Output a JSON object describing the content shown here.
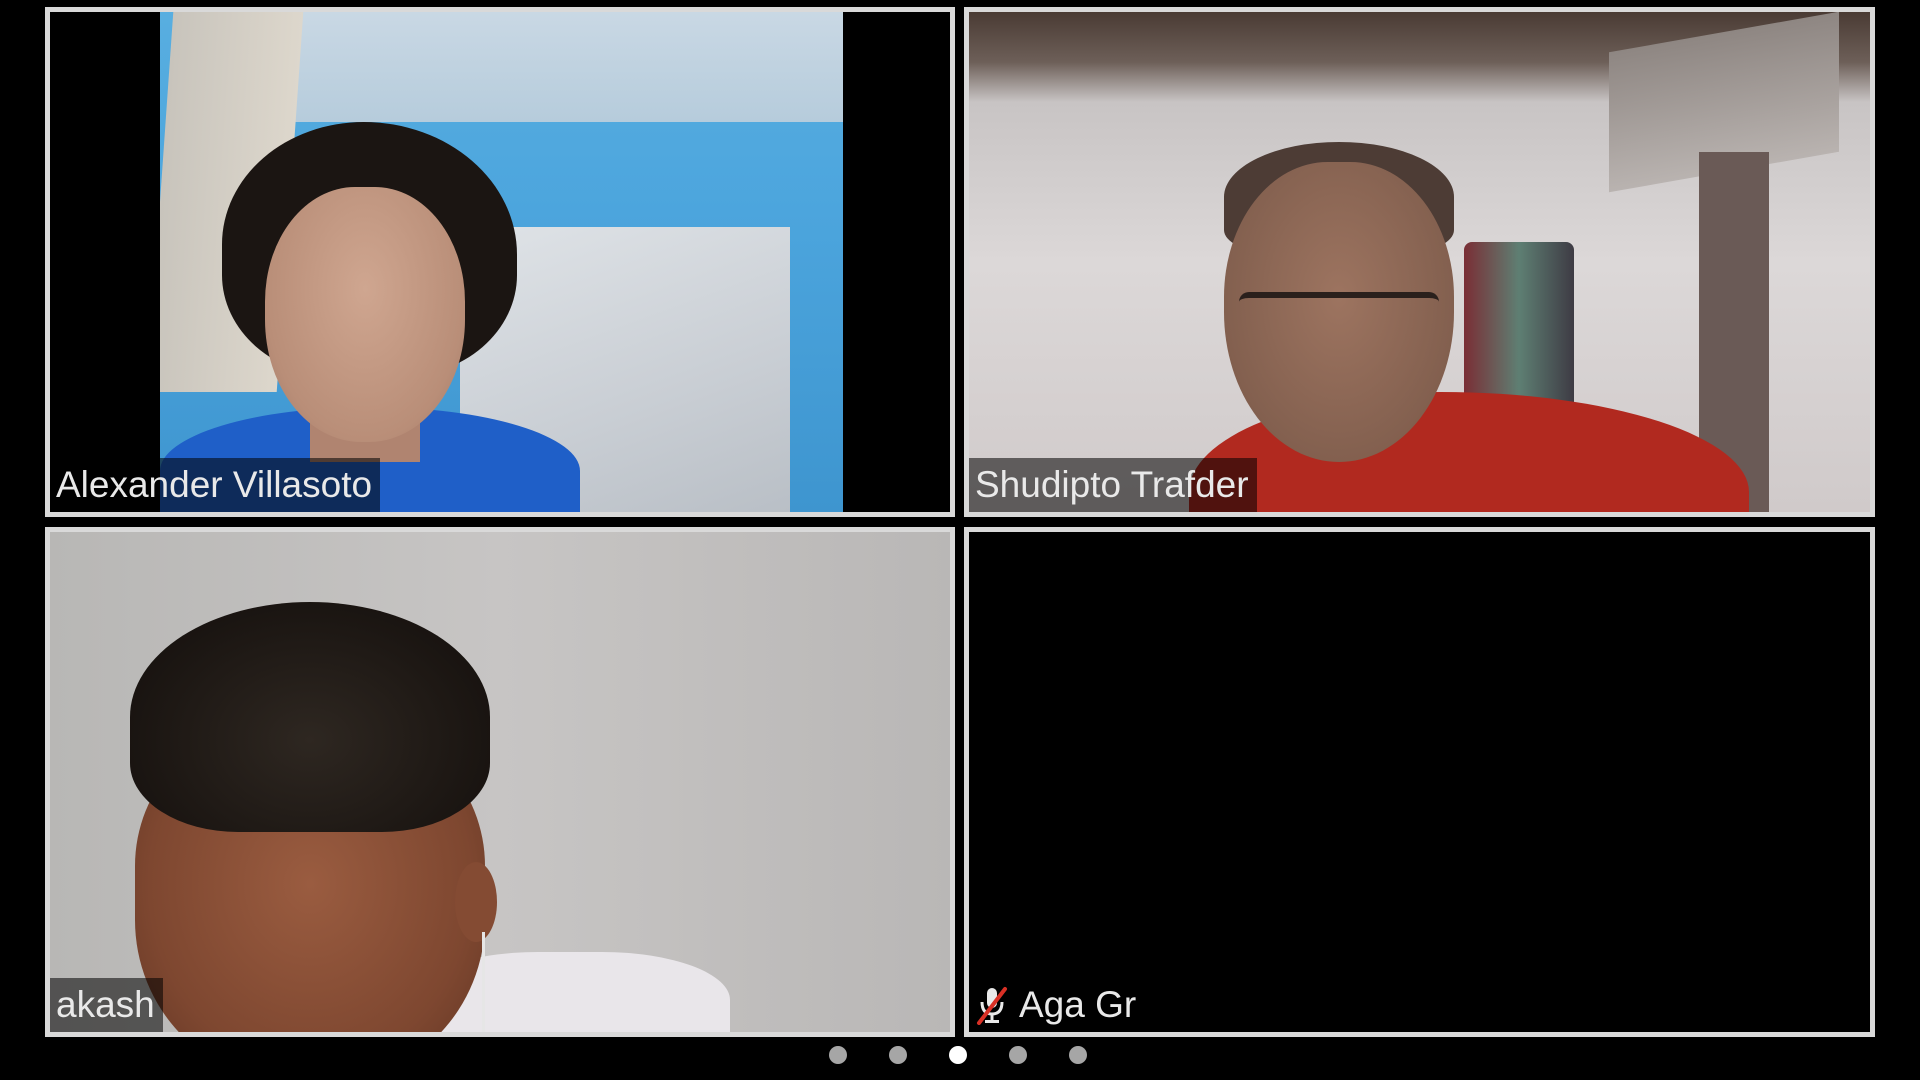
{
  "participants": [
    {
      "name": "Alexander Villasoto",
      "muted": false,
      "video_on": true
    },
    {
      "name": "Shudipto Trafder",
      "muted": false,
      "video_on": true
    },
    {
      "name": "akash",
      "muted": false,
      "video_on": true
    },
    {
      "name": "Aga Gr",
      "muted": true,
      "video_on": false
    }
  ],
  "pager": {
    "total_pages": 5,
    "current_page": 3
  },
  "colors": {
    "background": "#000000",
    "tile_border": "#d9d9d9",
    "label_text": "#e9e9e9",
    "muted_slash": "#d93025",
    "dot_active": "#ffffff",
    "dot_inactive": "#a6a6a6"
  },
  "icons": {
    "muted": "mic-muted-icon"
  }
}
